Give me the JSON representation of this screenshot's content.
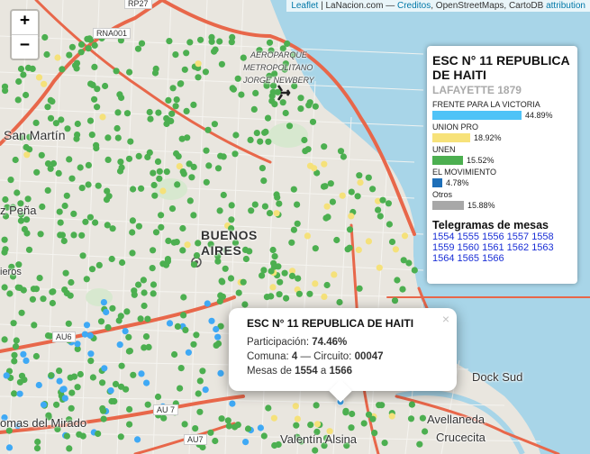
{
  "attribution": {
    "leaflet": "Leaflet",
    "sep1": " | LaNacion.com — ",
    "creditos": "Creditos",
    "sep2": ", OpenStreetMaps, CartoDB ",
    "attribution_link": "attribution"
  },
  "zoom": {
    "in": "+",
    "out": "−"
  },
  "map_labels": {
    "rp27": "RP27",
    "rna001": "RNA001",
    "aeroparque": "AEROPARQUE",
    "metropolitano": "METROPOLITANO",
    "jorge": "JORGE NEWBERY",
    "san_martin": "San Martín",
    "pena": "z Peña",
    "buenos": "BUENOS",
    "aires": "AIRES",
    "ieros": "ieros",
    "au6": "AU6",
    "au7a": "AU 7",
    "au7b": "AU7",
    "mirador": "omas del Mirado",
    "dock_sud": "Dock Sud",
    "avellaneda": "Avellaneda",
    "crucecita": "Crucecita",
    "valentin": "Valentín Alsina"
  },
  "panel": {
    "title": "ESC N° 11 REPUBLICA DE HAITI",
    "address": "LAFAYETTE 1879",
    "parties": [
      {
        "name": "FRENTE PARA LA VICTORIA",
        "pct": "44.89%",
        "value": 44.89,
        "color": "#4fc3f7"
      },
      {
        "name": "UNION PRO",
        "pct": "18.92%",
        "value": 18.92,
        "color": "#f7e27a"
      },
      {
        "name": "UNEN",
        "pct": "15.52%",
        "value": 15.52,
        "color": "#4caf50"
      },
      {
        "name": "EL MOVIMIENTO",
        "pct": "4.78%",
        "value": 4.78,
        "color": "#1e6fb8"
      },
      {
        "name": "Otros",
        "pct": "15.88%",
        "value": 15.88,
        "color": "#a8a8a8"
      }
    ],
    "telegrams_title": "Telegramas de mesas",
    "mesas": [
      "1554",
      "1555",
      "1556",
      "1557",
      "1558",
      "1559",
      "1560",
      "1561",
      "1562",
      "1563",
      "1564",
      "1565",
      "1566"
    ]
  },
  "popup": {
    "title": "ESC N° 11 REPUBLICA DE HAITI",
    "participation_label": "Participación:",
    "participation_value": "74.46%",
    "comuna_label": "Comuna:",
    "comuna_value": "4",
    "circuito_label": "— Circuito:",
    "circuito_value": "00047",
    "mesas_label": "Mesas de",
    "mesas_from": "1554",
    "mesas_a": "a",
    "mesas_to": "1566",
    "close": "×"
  },
  "colors": {
    "water": "#a8d5e8",
    "land": "#e9e6df",
    "highway": "#e8674a",
    "dot_green": "#4caf50",
    "dot_yellow": "#f5e17a",
    "dot_blue": "#3fa9f5"
  }
}
